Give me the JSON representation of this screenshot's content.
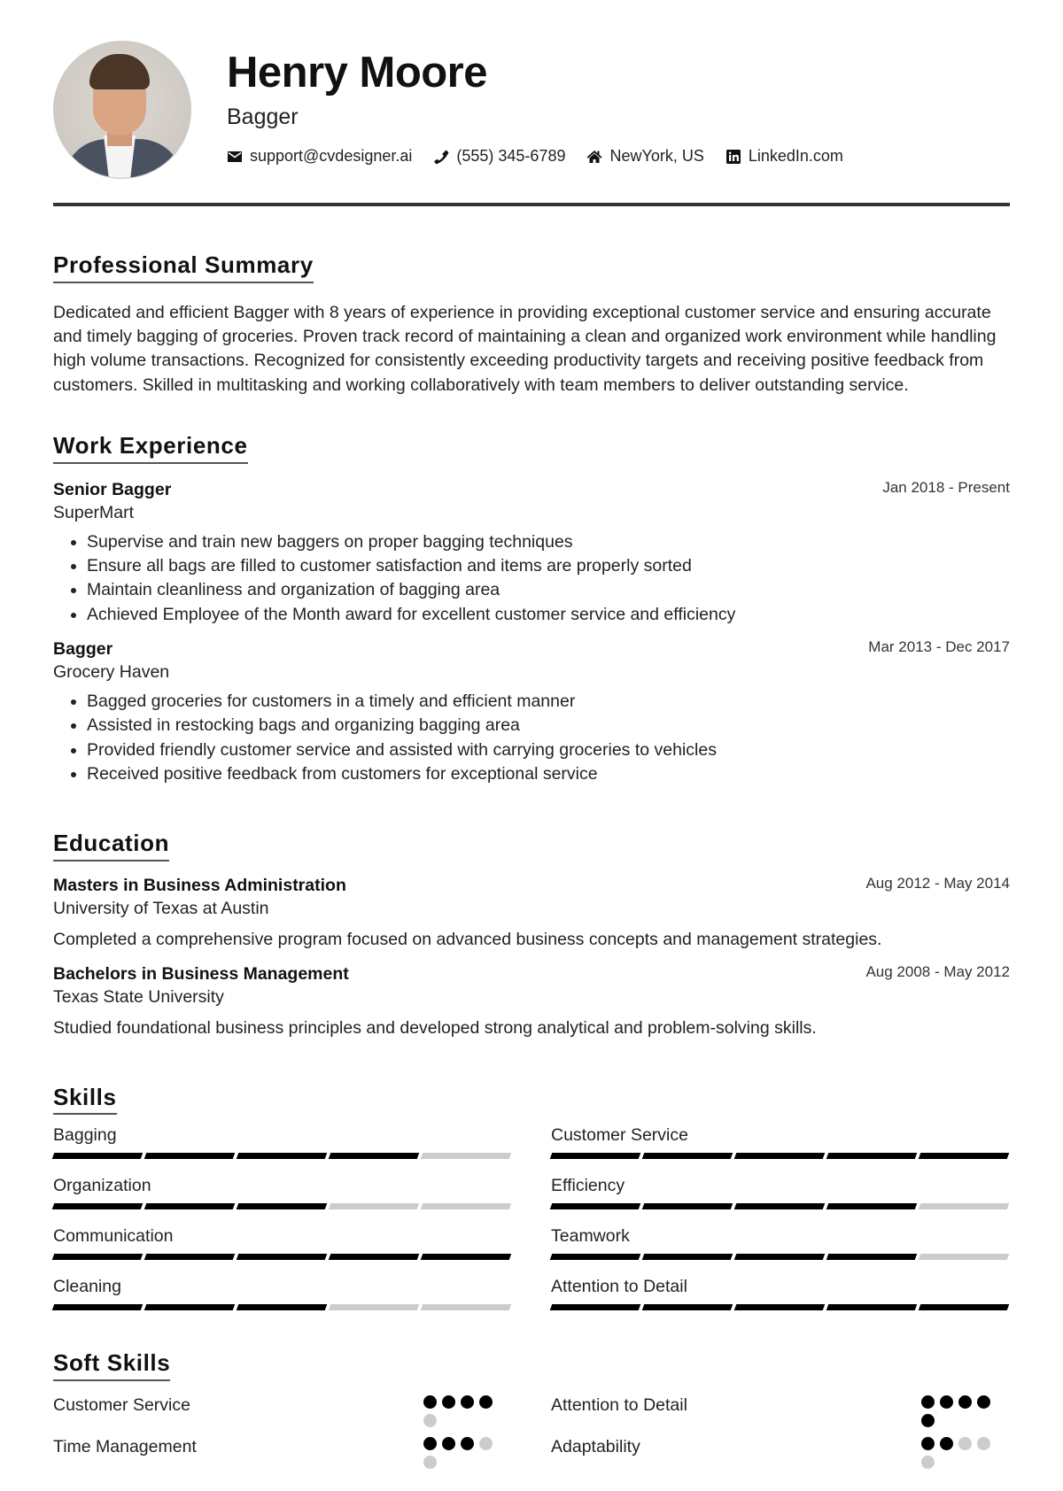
{
  "header": {
    "name": "Henry Moore",
    "title": "Bagger",
    "contacts": [
      {
        "icon": "envelope-icon",
        "text": "support@cvdesigner.ai"
      },
      {
        "icon": "phone-icon",
        "text": "(555) 345-6789"
      },
      {
        "icon": "home-icon",
        "text": "NewYork, US"
      },
      {
        "icon": "linkedin-icon",
        "text": "LinkedIn.com"
      }
    ]
  },
  "summary": {
    "heading": "Professional Summary",
    "text": "Dedicated and efficient Bagger with 8 years of experience in providing exceptional customer service and ensuring accurate and timely bagging of groceries. Proven track record of maintaining a clean and organized work environment while handling high volume transactions. Recognized for consistently exceeding productivity targets and receiving positive feedback from customers. Skilled in multitasking and working collaboratively with team members to deliver outstanding service."
  },
  "work": {
    "heading": "Work Experience",
    "entries": [
      {
        "title": "Senior Bagger",
        "org": "SuperMart",
        "date": "Jan 2018 - Present",
        "bullets": [
          "Supervise and train new baggers on proper bagging techniques",
          "Ensure all bags are filled to customer satisfaction and items are properly sorted",
          "Maintain cleanliness and organization of bagging area",
          "Achieved Employee of the Month award for excellent customer service and efficiency"
        ]
      },
      {
        "title": "Bagger",
        "org": "Grocery Haven",
        "date": "Mar 2013 - Dec 2017",
        "bullets": [
          "Bagged groceries for customers in a timely and efficient manner",
          "Assisted in restocking bags and organizing bagging area",
          "Provided friendly customer service and assisted with carrying groceries to vehicles",
          "Received positive feedback from customers for exceptional service"
        ]
      }
    ]
  },
  "education": {
    "heading": "Education",
    "entries": [
      {
        "title": "Masters in Business Administration",
        "org": "University of Texas at Austin",
        "date": "Aug 2012 - May 2014",
        "desc": "Completed a comprehensive program focused on advanced business concepts and management strategies."
      },
      {
        "title": "Bachelors in Business Management",
        "org": "Texas State University",
        "date": "Aug 2008 - May 2012",
        "desc": "Studied foundational business principles and developed strong analytical and problem-solving skills."
      }
    ]
  },
  "skills": {
    "heading": "Skills",
    "max": 5,
    "items": [
      {
        "name": "Bagging",
        "level": 4
      },
      {
        "name": "Customer Service",
        "level": 5
      },
      {
        "name": "Organization",
        "level": 3
      },
      {
        "name": "Efficiency",
        "level": 4
      },
      {
        "name": "Communication",
        "level": 5
      },
      {
        "name": "Teamwork",
        "level": 4
      },
      {
        "name": "Cleaning",
        "level": 3
      },
      {
        "name": "Attention to Detail",
        "level": 5
      }
    ]
  },
  "soft_skills": {
    "heading": "Soft Skills",
    "max": 5,
    "items": [
      {
        "name": "Customer Service",
        "level": 4
      },
      {
        "name": "Attention to Detail",
        "level": 5
      },
      {
        "name": "Time Management",
        "level": 3
      },
      {
        "name": "Adaptability",
        "level": 2
      }
    ]
  },
  "colors": {
    "text": "#222222",
    "accent": "#000000",
    "inactive": "#cccccc",
    "rule": "#333333"
  }
}
